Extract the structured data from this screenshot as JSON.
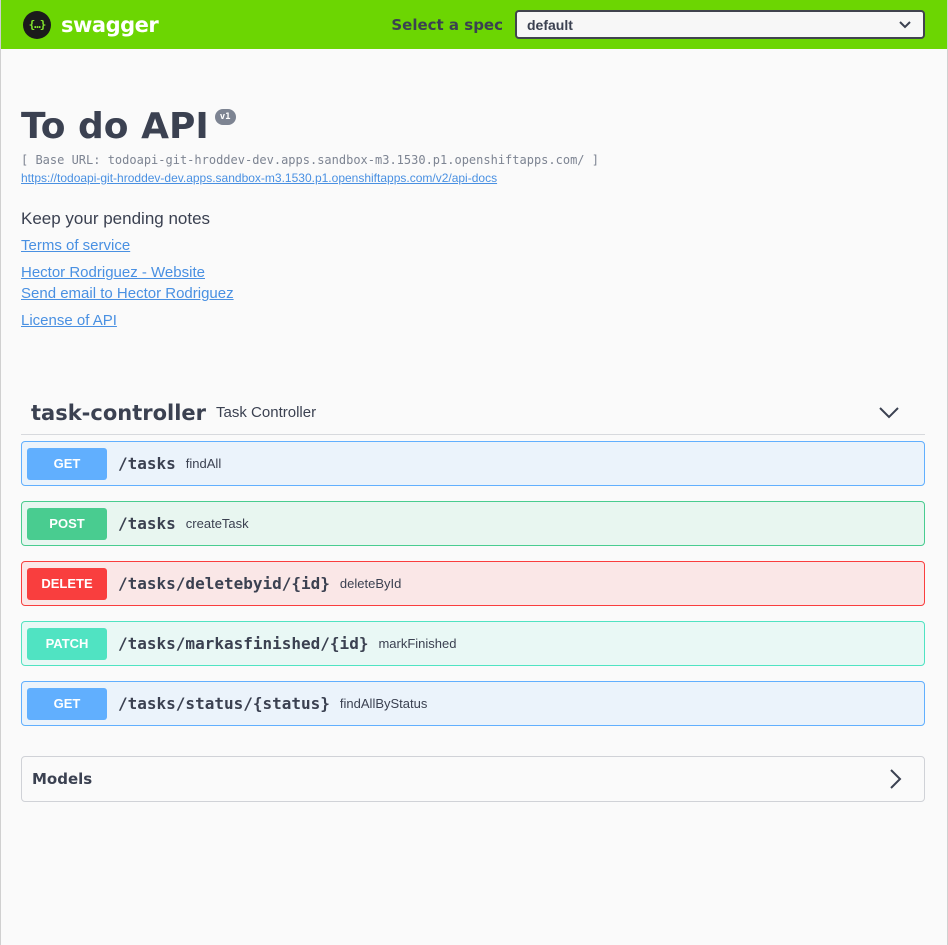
{
  "topbar": {
    "logo_mark": "{…}",
    "logo_text": "swagger",
    "spec_label": "Select a spec",
    "spec_value": "default"
  },
  "info": {
    "title": "To do API",
    "version": "v1",
    "base_url": "[ Base URL: todoapi-git-hroddev-dev.apps.sandbox-m3.1530.p1.openshiftapps.com/ ]",
    "docs_url": "https://todoapi-git-hroddev-dev.apps.sandbox-m3.1530.p1.openshiftapps.com/v2/api-docs",
    "description": "Keep your pending notes",
    "terms": "Terms of service",
    "website": "Hector Rodriguez - Website",
    "email": "Send email to Hector Rodriguez",
    "license": "License of API"
  },
  "tag": {
    "name": "task-controller",
    "description": "Task Controller"
  },
  "operations": [
    {
      "method": "GET",
      "path": "/tasks",
      "summary": "findAll"
    },
    {
      "method": "POST",
      "path": "/tasks",
      "summary": "createTask"
    },
    {
      "method": "DELETE",
      "path": "/tasks/deletebyid/{id}",
      "summary": "deleteById"
    },
    {
      "method": "PATCH",
      "path": "/tasks/markasfinished/{id}",
      "summary": "markFinished"
    },
    {
      "method": "GET",
      "path": "/tasks/status/{status}",
      "summary": "findAllByStatus"
    }
  ],
  "models": {
    "title": "Models"
  },
  "colors": {
    "topbar": "#6cd602",
    "get": "#61affe",
    "post": "#49cc90",
    "delete": "#f93e3e",
    "patch": "#50e3c2",
    "link": "#4990e2"
  }
}
